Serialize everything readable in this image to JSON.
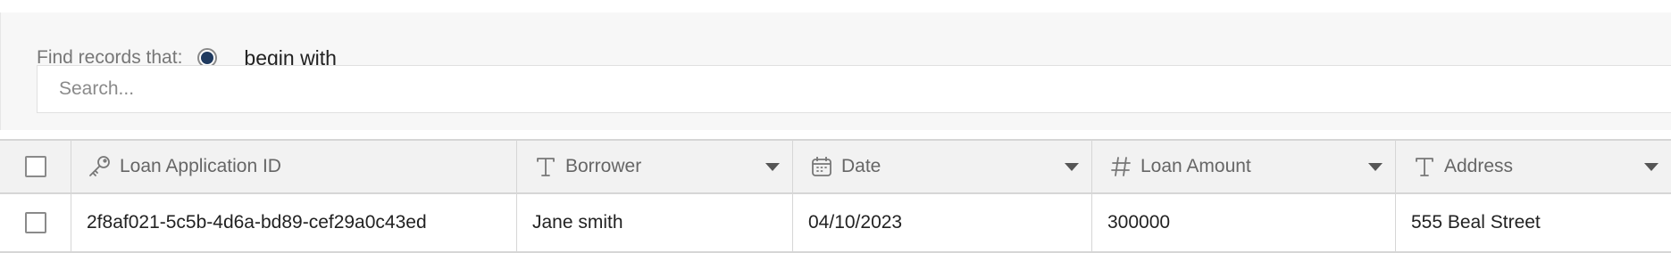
{
  "search": {
    "find_label": "Find records that:",
    "option_label": "begin with",
    "placeholder": "Search..."
  },
  "columns": [
    {
      "label": "Loan Application ID",
      "icon": "key-icon"
    },
    {
      "label": "Borrower",
      "icon": "text-type-icon"
    },
    {
      "label": "Date",
      "icon": "calendar-icon"
    },
    {
      "label": "Loan Amount",
      "icon": "hash-icon"
    },
    {
      "label": "Address",
      "icon": "text-type-icon"
    }
  ],
  "rows": [
    {
      "loan_application_id": "2f8af021-5c5b-4d6a-bd89-cef29a0c43ed",
      "borrower": "Jane smith",
      "date": "04/10/2023",
      "loan_amount": "300000",
      "address": "555 Beal Street"
    }
  ],
  "colors": {
    "radio_selected": "#1f3a5f",
    "panel_bg": "#f7f7f7",
    "header_bg": "#f2f2f2"
  }
}
